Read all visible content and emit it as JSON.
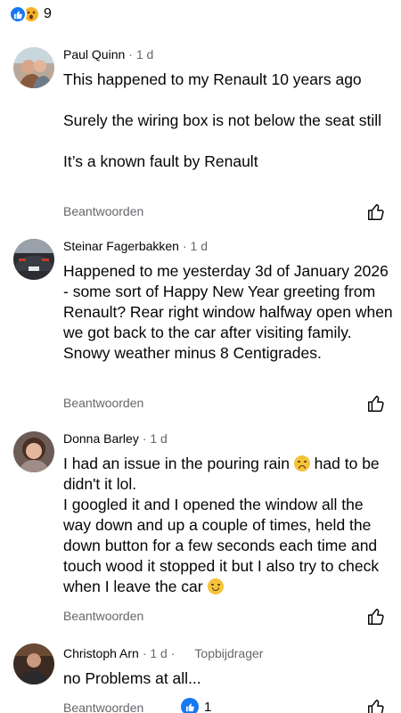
{
  "reactions": {
    "count": "9",
    "types": [
      "like-icon",
      "wow-icon"
    ]
  },
  "reply_label": "Beantwoorden",
  "comments": [
    {
      "name": "Paul Quinn",
      "time": "· 1 d",
      "lines": [
        "This happened to my Renault 10 years ago",
        "",
        "Surely the wiring box is not below the seat still",
        "",
        "It’s a known fault by Renault"
      ]
    },
    {
      "name": "Steinar Fagerbakken",
      "time": "· 1 d",
      "text": "Happened to me yesterday 3d of January 2026 - some sort of Happy New Year greeting from Renault? Rear right window halfway open when we got back to the car after visiting family. Snowy weather minus 8 Centigrades."
    },
    {
      "name": "Donna Barley",
      "time": "· 1 d",
      "text_a": "I had an issue in the pouring rain",
      "text_b": "had to be didn't it lol.",
      "text_c": "I googled it and I opened the window all the way down and up a couple of times, held the down button for a few seconds each time and touch wood it stopped it but I also try to check when I leave the car"
    },
    {
      "name": "Christoph Arn",
      "time": "· 1 d ·",
      "tag": "Topbijdrager",
      "text": "no Problems at all...",
      "like_count": "1"
    }
  ],
  "colors": {
    "accent": "#1877f2",
    "meta": "#65676b",
    "text": "#050505"
  }
}
